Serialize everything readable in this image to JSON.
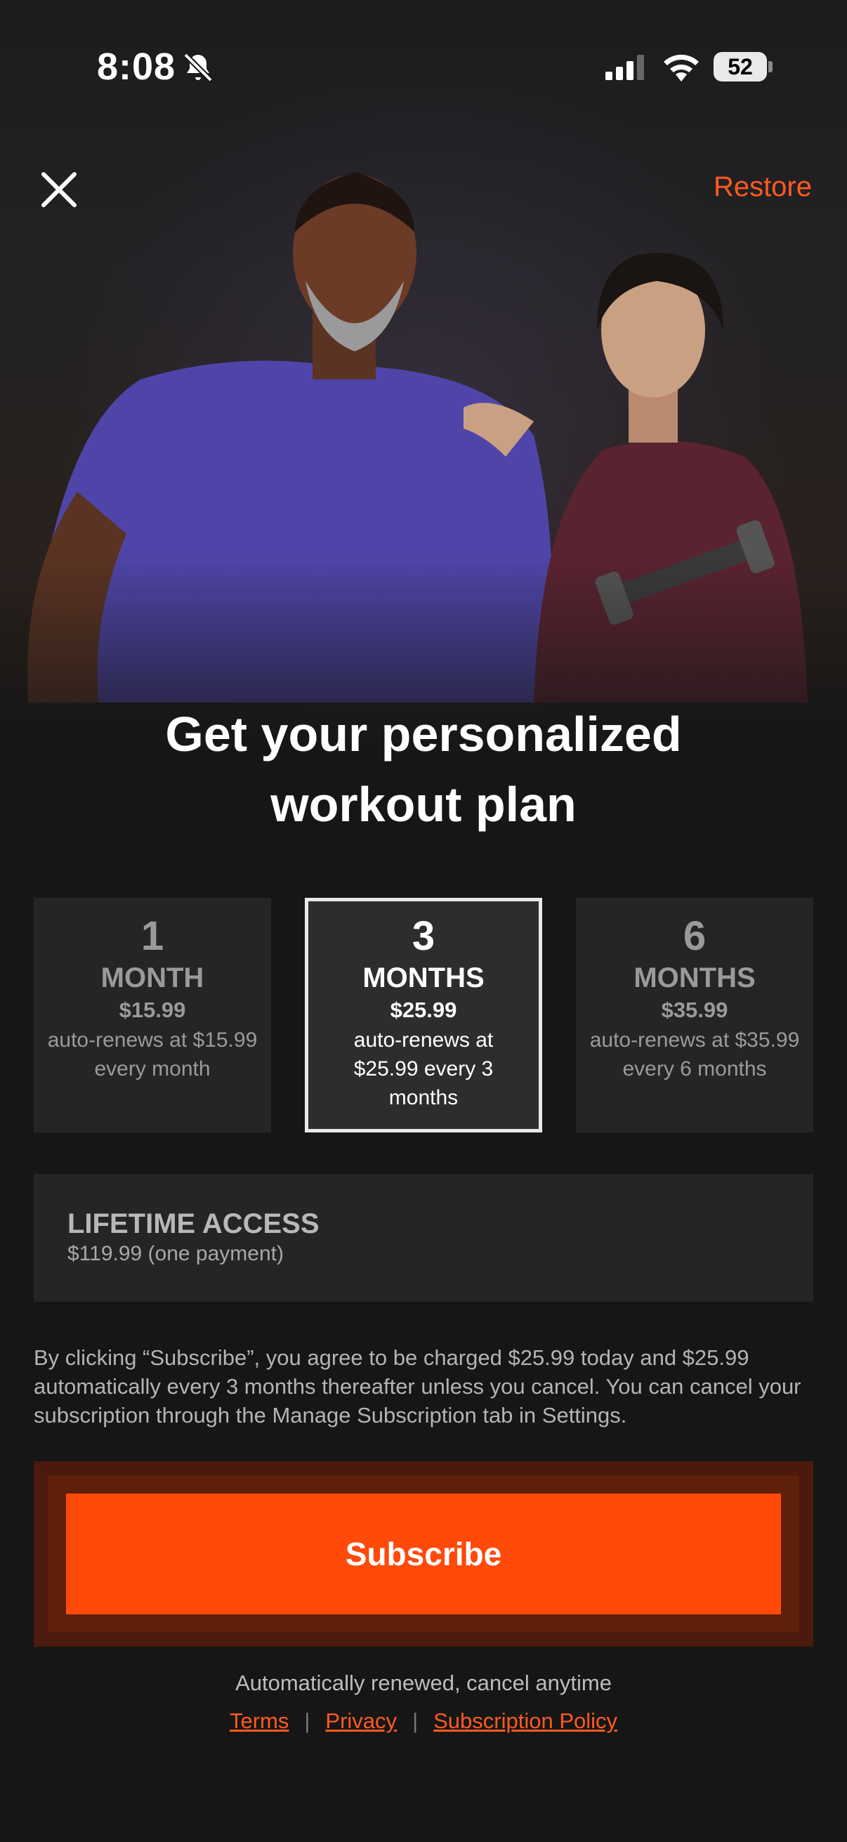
{
  "status_bar": {
    "time": "8:08",
    "battery": "52"
  },
  "header": {
    "restore_label": "Restore"
  },
  "headline": {
    "line1": "Get your personalized",
    "line2": "workout plan"
  },
  "plans": [
    {
      "num": "1",
      "unit": "MONTH",
      "price": "$15.99",
      "renew": "auto-renews at $15.99 every month",
      "selected": false
    },
    {
      "num": "3",
      "unit": "MONTHS",
      "price": "$25.99",
      "renew": "auto-renews at $25.99 every 3 months",
      "selected": true
    },
    {
      "num": "6",
      "unit": "MONTHS",
      "price": "$35.99",
      "renew": "auto-renews at $35.99 every 6 months",
      "selected": false
    }
  ],
  "lifetime": {
    "title": "LIFETIME ACCESS",
    "price": "$119.99  (one payment)"
  },
  "legal_text": "By clicking “Subscribe”, you agree to be charged $25.99 today and $25.99 automatically every 3 months thereafter unless you cancel. You can cancel your subscription through the Manage Subscription tab in Settings.",
  "subscribe_label": "Subscribe",
  "footer": {
    "auto_text": "Automatically renewed, cancel anytime",
    "terms": "Terms",
    "privacy": "Privacy",
    "policy": "Subscription Policy"
  },
  "colors": {
    "accent": "#ff4a0a",
    "link": "#ff5a1f",
    "background": "#161616",
    "card": "#252527"
  },
  "icons": {
    "close": "close-icon",
    "bell_muted": "bell-slash-icon",
    "signal": "cellular-signal-icon",
    "wifi": "wifi-icon",
    "battery": "battery-icon"
  }
}
